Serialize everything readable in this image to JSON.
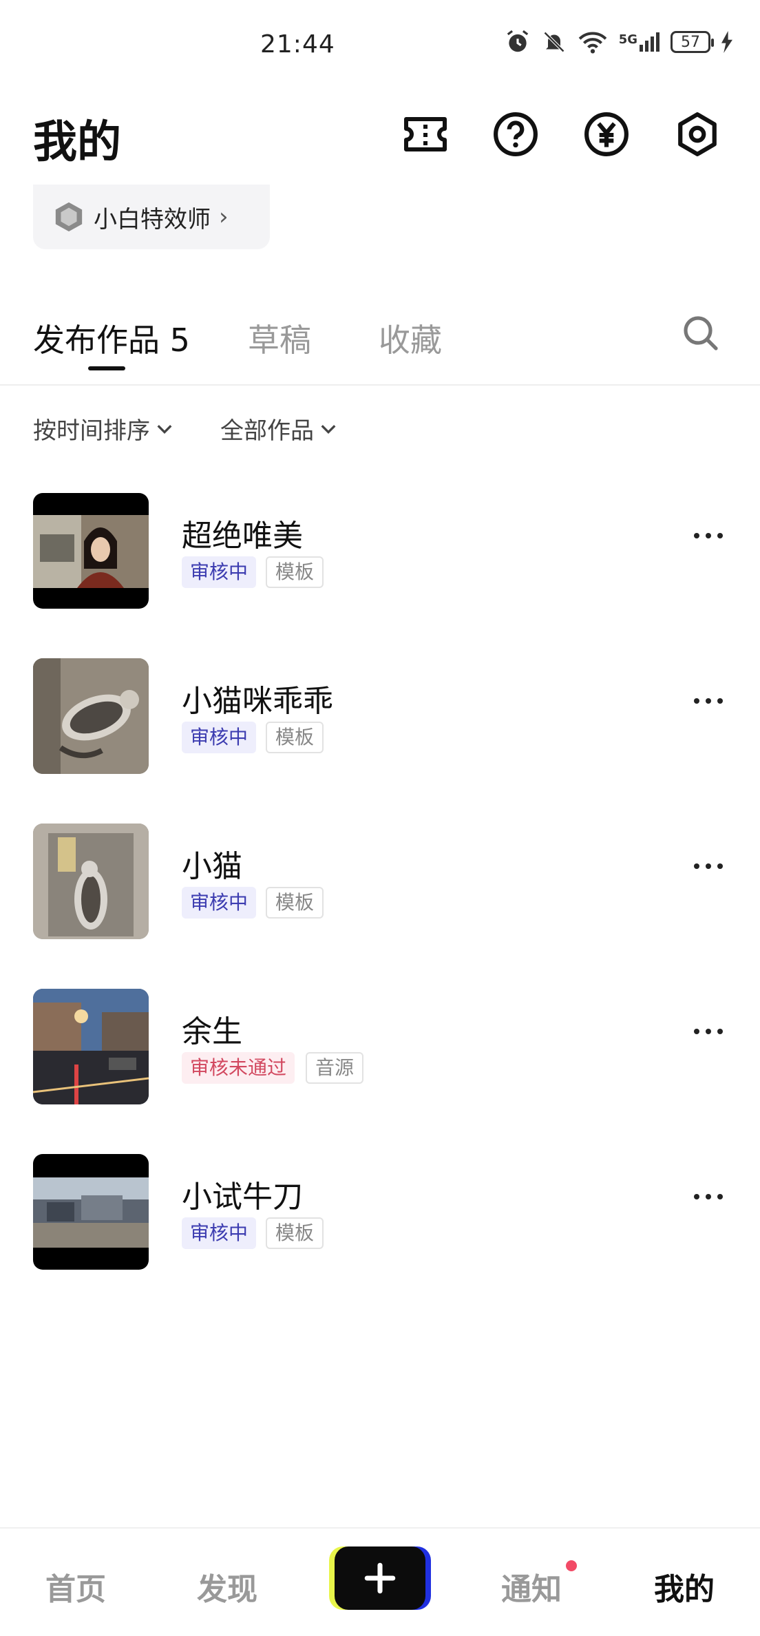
{
  "status_bar": {
    "time": "21:44",
    "network": "5G",
    "battery": "57"
  },
  "header": {
    "title": "我的",
    "icons": [
      "ticket-icon",
      "help-icon",
      "yuan-icon",
      "settings-icon"
    ]
  },
  "level_chip": {
    "label": "小白特效师",
    "chevron": "›"
  },
  "tabs": [
    {
      "label": "发布作品 5",
      "active": true
    },
    {
      "label": "草稿",
      "active": false
    },
    {
      "label": "收藏",
      "active": false
    }
  ],
  "filters": {
    "sort_label": "按时间排序",
    "category_label": "全部作品"
  },
  "works": [
    {
      "title": "超绝唯美",
      "status": "审核中",
      "type": "模板"
    },
    {
      "title": "小猫咪乖乖",
      "status": "审核中",
      "type": "模板"
    },
    {
      "title": "小猫",
      "status": "审核中",
      "type": "模板"
    },
    {
      "title": "余生",
      "status": "审核未通过",
      "type": "音源"
    },
    {
      "title": "小试牛刀",
      "status": "审核中",
      "type": "模板"
    }
  ],
  "bottom_nav": {
    "home": "首页",
    "discover": "发现",
    "notify": "通知",
    "mine": "我的",
    "create_icon": "plus-icon"
  },
  "colors": {
    "review_badge_text": "#3c3cb0",
    "rejected_badge_text": "#d2485f",
    "notif_dot": "#f24a66"
  }
}
